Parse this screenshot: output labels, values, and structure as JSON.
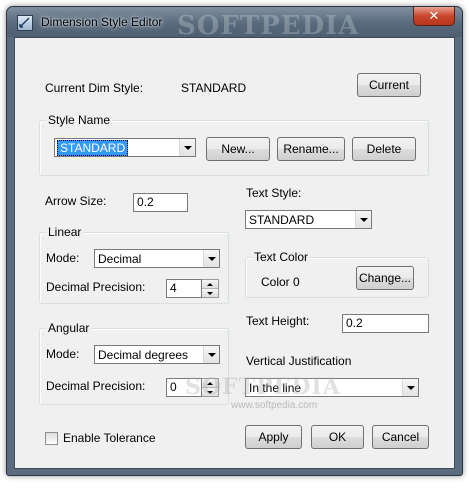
{
  "window": {
    "title": "Dimension Style Editor",
    "watermark": "SOFTPEDIA",
    "close_glyph": "✕"
  },
  "current": {
    "label": "Current Dim Style:",
    "value": "STANDARD",
    "button": "Current"
  },
  "style_name": {
    "group_title": "Style Name",
    "selected": "STANDARD",
    "new_button": "New...",
    "rename_button": "Rename...",
    "delete_button": "Delete"
  },
  "arrow_size": {
    "label": "Arrow Size:",
    "value": "0.2"
  },
  "linear": {
    "group_title": "Linear",
    "mode_label": "Mode:",
    "mode_value": "Decimal",
    "precision_label": "Decimal Precision:",
    "precision_value": "4"
  },
  "angular": {
    "group_title": "Angular",
    "mode_label": "Mode:",
    "mode_value": "Decimal degrees",
    "precision_label": "Decimal Precision:",
    "precision_value": "0"
  },
  "text_style": {
    "label": "Text Style:",
    "value": "STANDARD"
  },
  "text_color": {
    "group_title": "Text Color",
    "value": "Color 0",
    "button": "Change..."
  },
  "text_height": {
    "label": "Text Height:",
    "value": "0.2"
  },
  "vertical_justification": {
    "label": "Vertical Justification",
    "value": "In the line"
  },
  "tolerance": {
    "label": "Enable Tolerance"
  },
  "buttons": {
    "apply": "Apply",
    "ok": "OK",
    "cancel": "Cancel"
  },
  "footer_watermark": {
    "big": "SOFTPEDIA",
    "small": "www.softpedia.com"
  },
  "colors": {
    "selection": "#3399ff",
    "title_bar": "#5b6c7e",
    "close": "#c9462c",
    "dialog_bg": "#f0f0f0"
  }
}
